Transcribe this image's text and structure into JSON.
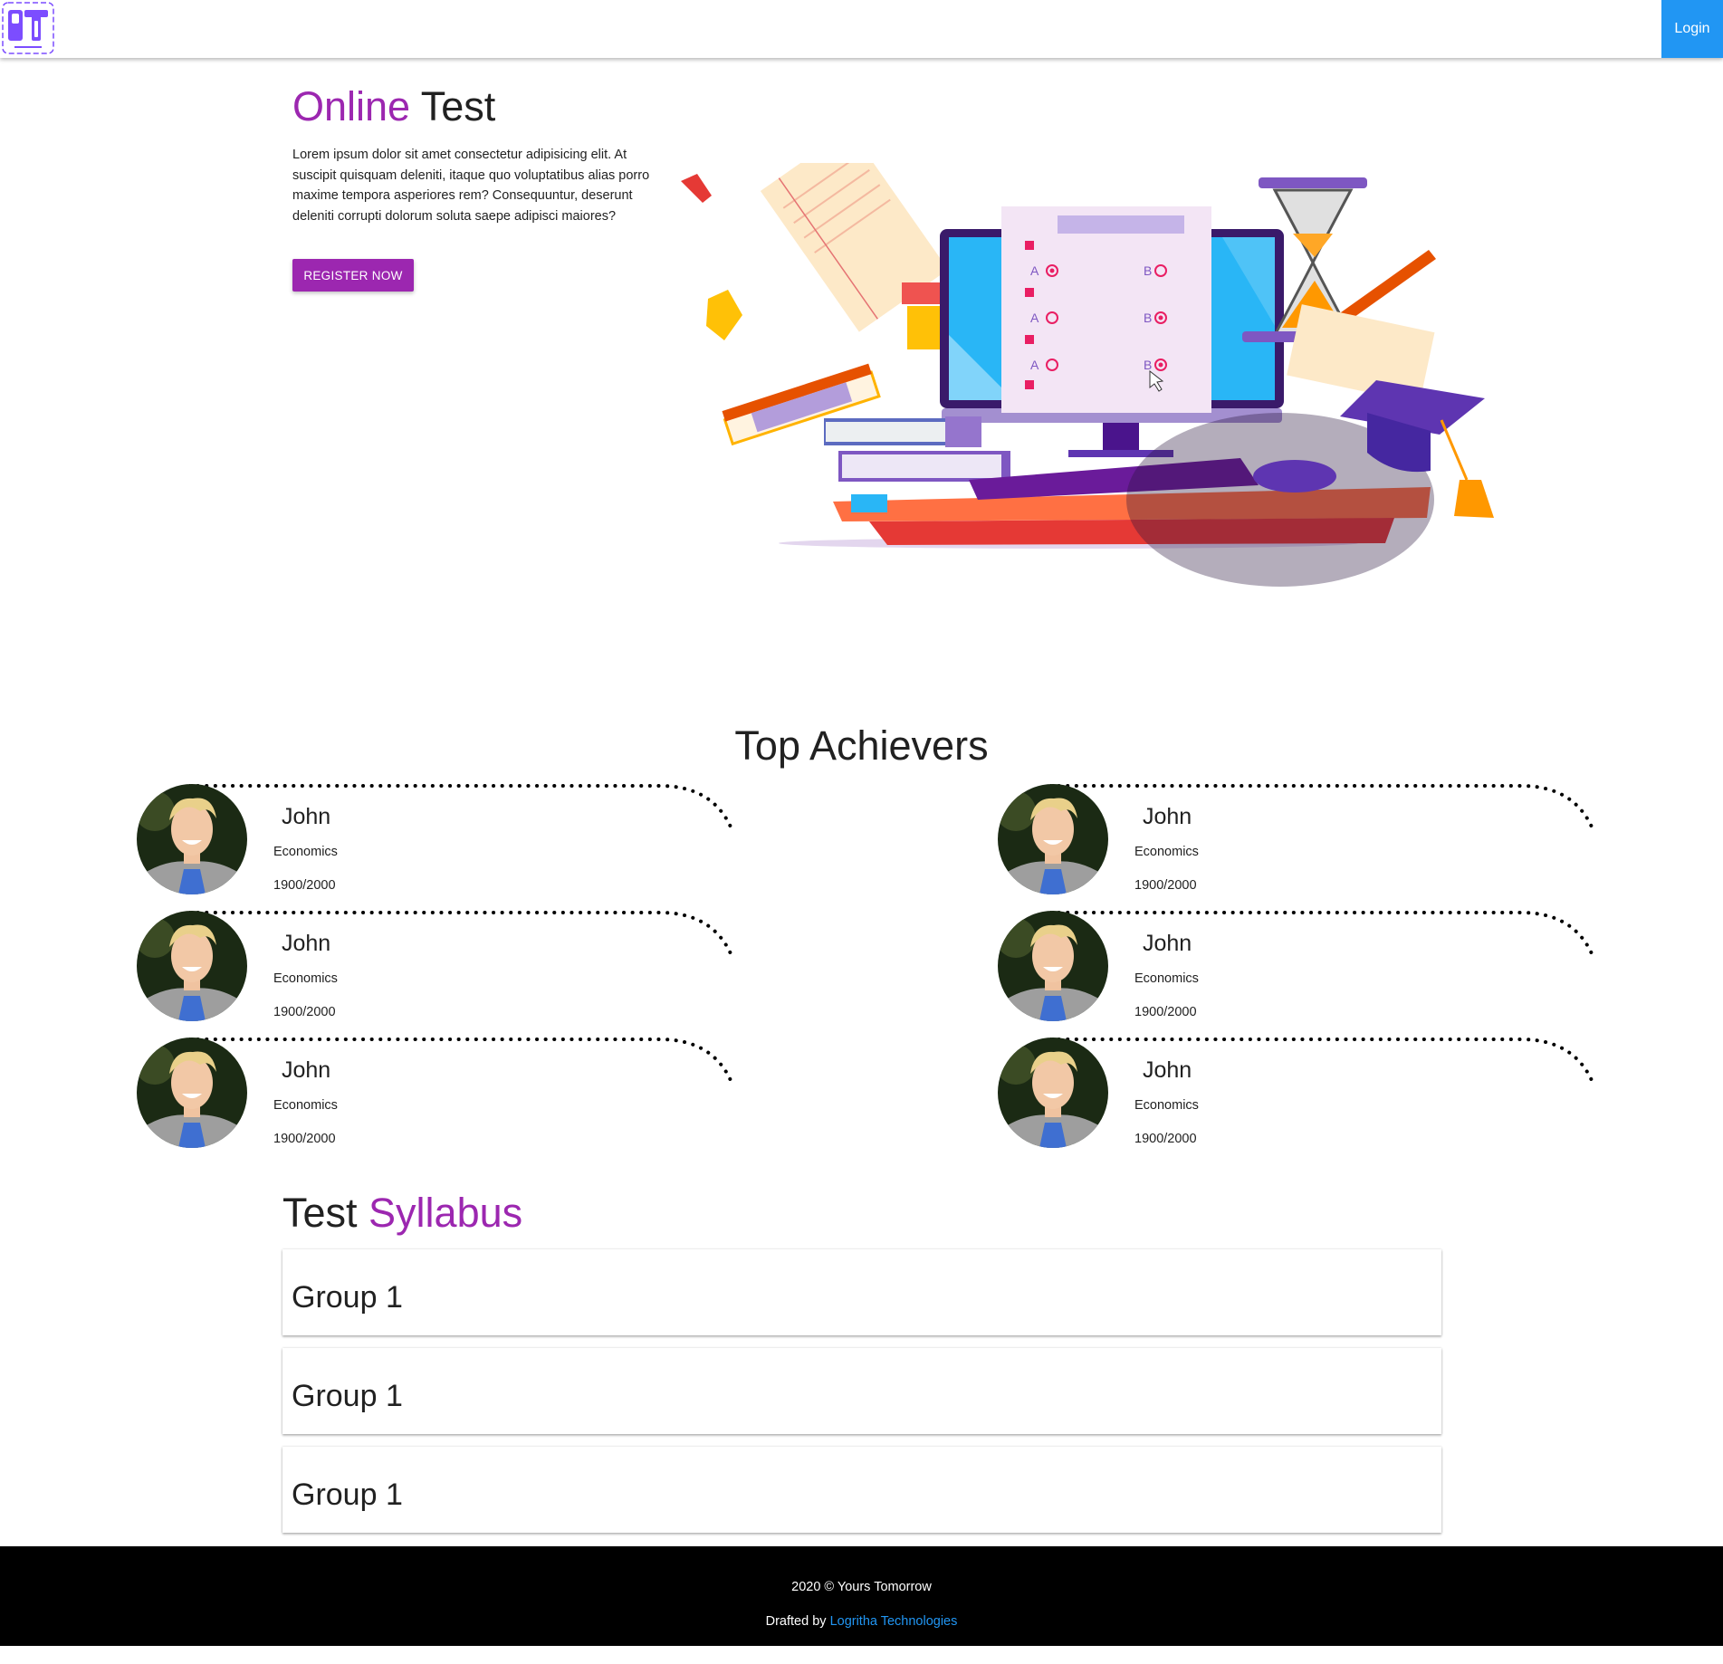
{
  "navbar": {
    "logo_text": "YT",
    "login_label": "Login",
    "login_color": "#2196f3"
  },
  "hero": {
    "title_part1": "Online",
    "title_part2": "Test",
    "text": "Lorem ipsum dolor sit amet consectetur adipisicing elit. At suscipit quisquam deleniti, itaque quo voluptatibus alias porro maxime tempora asperiores rem? Consequuntur, deserunt deleniti corrupti dolorum soluta saepe adipisci maiores?",
    "register_label": "REGISTER NOW",
    "accent_color": "#9c27b0",
    "quiz_labels": [
      "A",
      "B",
      "A",
      "B",
      "A",
      "B"
    ]
  },
  "achievers": {
    "title": "Top Achievers",
    "items": [
      {
        "name": "John",
        "subject": "Economics",
        "score": "1900/2000"
      },
      {
        "name": "John",
        "subject": "Economics",
        "score": "1900/2000"
      },
      {
        "name": "John",
        "subject": "Economics",
        "score": "1900/2000"
      },
      {
        "name": "John",
        "subject": "Economics",
        "score": "1900/2000"
      },
      {
        "name": "John",
        "subject": "Economics",
        "score": "1900/2000"
      },
      {
        "name": "John",
        "subject": "Economics",
        "score": "1900/2000"
      }
    ]
  },
  "syllabus": {
    "title_part1": "Test",
    "title_part2": "Syllabus",
    "groups": [
      "Group 1",
      "Group 1",
      "Group 1"
    ]
  },
  "footer": {
    "copyright": "2020 © Yours Tomorrow",
    "drafted_prefix": "Drafted by",
    "drafted_link": "Logritha Technologies",
    "link_color": "#2196f3",
    "background": "#000000"
  }
}
